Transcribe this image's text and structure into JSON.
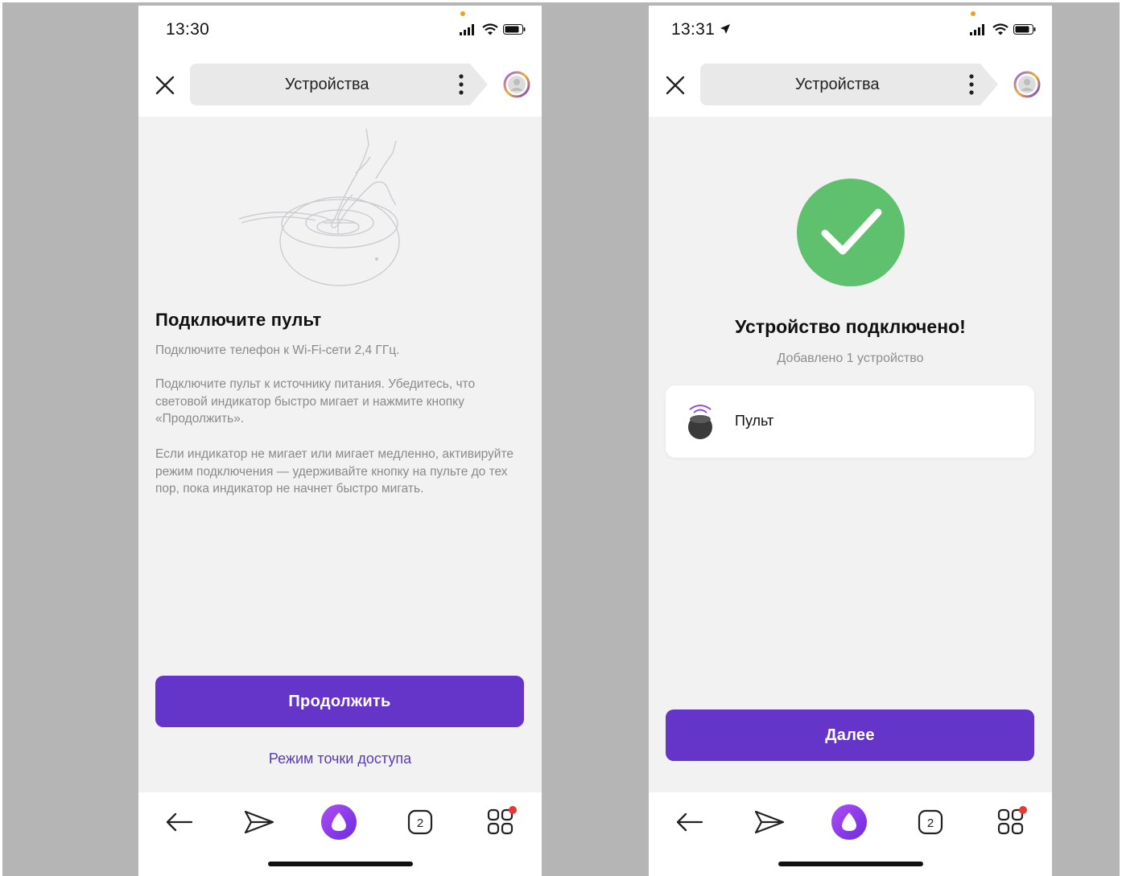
{
  "left_screen": {
    "status": {
      "time": "13:30"
    },
    "header": {
      "title": "Устройства"
    },
    "heading": "Подключите пульт",
    "paragraphs": [
      "Подключите телефон к Wi-Fi-сети 2,4 ГГц.",
      "Подключите пульт к источнику питания. Убедитесь, что световой индикатор быстро мигает и нажмите кнопку «Продолжить».",
      "Если индикатор не мигает или мигает медленно, активируйте режим подключения — удерживайте кнопку на пульте до тех пор, пока индикатор не начнет быстро мигать."
    ],
    "primary_button": "Продолжить",
    "secondary_link": "Режим точки доступа",
    "tabs_count": "2"
  },
  "right_screen": {
    "status": {
      "time": "13:31"
    },
    "header": {
      "title": "Устройства"
    },
    "success_title": "Устройство подключено!",
    "success_subtitle": "Добавлено 1 устройство",
    "device": {
      "name": "Пульт",
      "icon": "remote-icon"
    },
    "primary_button": "Далее",
    "tabs_count": "2"
  },
  "colors": {
    "accent": "#6534c8",
    "success": "#5fc06e",
    "notification_dot": "#e53935"
  }
}
